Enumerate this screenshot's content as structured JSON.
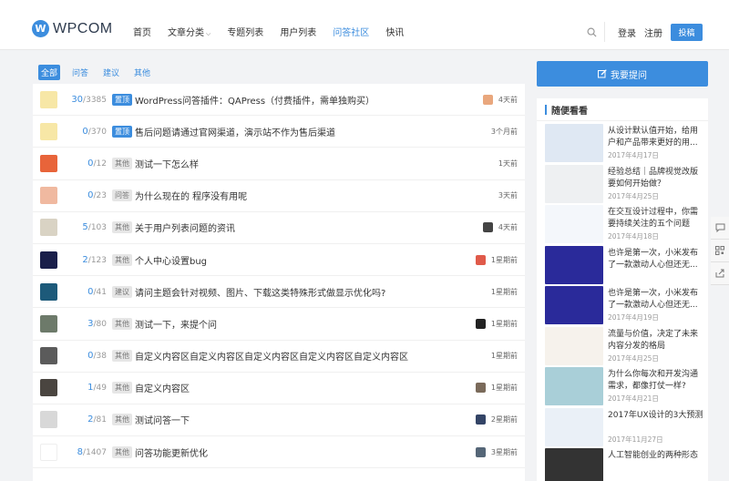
{
  "header": {
    "logo_mark": "W",
    "logo_text": "WPCOM",
    "nav": [
      {
        "label": "首页",
        "active": false,
        "caret": false
      },
      {
        "label": "文章分类",
        "active": false,
        "caret": true
      },
      {
        "label": "专题列表",
        "active": false,
        "caret": false
      },
      {
        "label": "用户列表",
        "active": false,
        "caret": false
      },
      {
        "label": "问答社区",
        "active": true,
        "caret": false
      },
      {
        "label": "快讯",
        "active": false,
        "caret": false
      }
    ],
    "login": "登录",
    "register": "注册",
    "post": "投稿"
  },
  "tabs": [
    {
      "label": "全部",
      "active": true
    },
    {
      "label": "问答",
      "active": false
    },
    {
      "label": "建议",
      "active": false
    },
    {
      "label": "其他",
      "active": false
    }
  ],
  "questions": [
    {
      "answers": "30",
      "views": "3385",
      "tag": "置顶",
      "tag_type": "top",
      "title": "WordPress问答插件：QAPress（付费插件，需单独购买）",
      "time": "4天前",
      "avatar": "#f7e7a6",
      "small_avatar": "#e9a77d"
    },
    {
      "answers": "0",
      "views": "370",
      "tag": "置顶",
      "tag_type": "top",
      "title": "售后问题请通过官网渠道，演示站不作为售后渠道",
      "time": "3个月前",
      "avatar": "#f7e7a6",
      "small_avatar": ""
    },
    {
      "answers": "0",
      "views": "12",
      "tag": "其他",
      "tag_type": "other",
      "title": "测试一下怎么样",
      "time": "1天前",
      "avatar": "#e8643a",
      "small_avatar": ""
    },
    {
      "answers": "0",
      "views": "23",
      "tag": "问答",
      "tag_type": "other",
      "title": "为什么现在的 程序没有用呢",
      "time": "3天前",
      "avatar": "#f0b9a0",
      "small_avatar": ""
    },
    {
      "answers": "5",
      "views": "103",
      "tag": "其他",
      "tag_type": "other",
      "title": "关于用户列表问题的资讯",
      "time": "4天前",
      "avatar": "#d9d3c4",
      "small_avatar": "#444444"
    },
    {
      "answers": "2",
      "views": "123",
      "tag": "其他",
      "tag_type": "other",
      "title": "个人中心设置bug",
      "time": "1星期前",
      "avatar": "#1a1f4a",
      "small_avatar": "#e05a4a"
    },
    {
      "answers": "0",
      "views": "41",
      "tag": "建议",
      "tag_type": "sugg",
      "title": "请问主题会针对视频、图片、下载这类特殊形式做显示优化吗?",
      "time": "1星期前",
      "avatar": "#1d5a7a",
      "small_avatar": ""
    },
    {
      "answers": "3",
      "views": "80",
      "tag": "其他",
      "tag_type": "other",
      "title": "测试一下，来提个问",
      "time": "1星期前",
      "avatar": "#6d7a6a",
      "small_avatar": "#222222"
    },
    {
      "answers": "0",
      "views": "38",
      "tag": "其他",
      "tag_type": "other",
      "title": "自定义内容区自定义内容区自定义内容区自定义内容区自定义内容区",
      "time": "1星期前",
      "avatar": "#5b5b5b",
      "small_avatar": ""
    },
    {
      "answers": "1",
      "views": "49",
      "tag": "其他",
      "tag_type": "other",
      "title": "自定义内容区",
      "time": "1星期前",
      "avatar": "#4a4540",
      "small_avatar": "#7a6a5a"
    },
    {
      "answers": "2",
      "views": "81",
      "tag": "其他",
      "tag_type": "other",
      "title": "测试问答一下",
      "time": "2星期前",
      "avatar": "#d8d8d8",
      "small_avatar": "#334466"
    },
    {
      "answers": "8",
      "views": "1407",
      "tag": "其他",
      "tag_type": "other",
      "title": "问答功能更新优化",
      "time": "3星期前",
      "avatar": "#ffffff",
      "small_avatar": "#556677"
    }
  ],
  "sidebar": {
    "ask_button": "我要提问",
    "widget_title": "随便看看",
    "posts": [
      {
        "title": "从设计默认值开始，给用户和产品带来更好的用...",
        "date": "2017年4月17日",
        "thumb": "#dfe8f3"
      },
      {
        "title": "经验总结｜品牌视觉改版要如何开始做？",
        "date": "2017年4月25日",
        "thumb": "#eef0f2"
      },
      {
        "title": "在交互设计过程中，你需要持续关注的五个问题",
        "date": "2017年4月18日",
        "thumb": "#f4f7fb"
      },
      {
        "title": "也许是第一次，小米发布了一款激动人心但还无...",
        "date": "",
        "thumb": "#2a2a9a"
      },
      {
        "title": "也许是第一次，小米发布了一款激动人心但还无...",
        "date": "2017年4月19日",
        "thumb": "#2a2a9a"
      },
      {
        "title": "流量与价值，决定了未来内容分发的格局",
        "date": "2017年4月25日",
        "thumb": "#f6f2ec"
      },
      {
        "title": "为什么你每次和开发沟通需求，都像打仗一样?",
        "date": "2017年4月21日",
        "thumb": "#a9cfd8"
      },
      {
        "title": "2017年UX设计的3大预测",
        "date": "2017年11月27日",
        "thumb": "#eaf0f7"
      },
      {
        "title": "人工智能创业的两种形态",
        "date": "",
        "thumb": "#333333"
      }
    ]
  },
  "icons": {
    "search": "search-icon",
    "comment": "comment-icon",
    "qrcode": "qrcode-icon",
    "share": "share-icon",
    "edit": "edit-icon"
  },
  "colors": {
    "accent": "#3c8dde",
    "background": "#f2f3f5"
  }
}
